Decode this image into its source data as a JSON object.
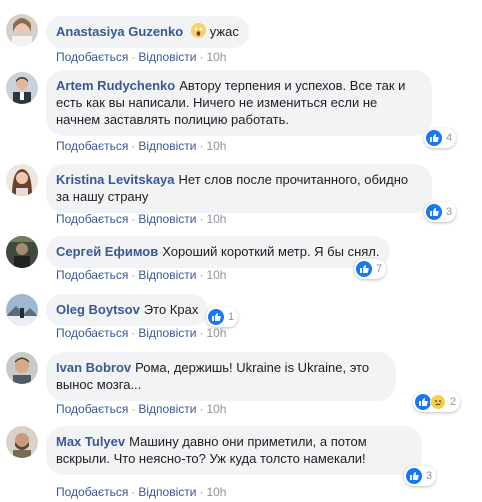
{
  "labels": {
    "like": "Подобається",
    "reply": "Відповісти",
    "sep": "·"
  },
  "comments": [
    {
      "author": "Anastasiya Guzenko",
      "text": "ужас",
      "time": "10h",
      "reactions": null
    },
    {
      "author": "Artem Rudychenko",
      "text": "Автору терпения и успехов. Все так и есть как вы написали. Ничего не измениться если не начнем заставлять полицию работать.",
      "time": "10h",
      "reactions": {
        "count": "4"
      }
    },
    {
      "author": "Kristina Levitskaya",
      "text": "Нет слов после прочитанного, обидно за нашу страну",
      "time": "10h",
      "reactions": {
        "count": "3"
      }
    },
    {
      "author": "Сергей Ефимов",
      "text": "Хороший короткий метр. Я бы снял.",
      "time": "10h",
      "reactions": {
        "count": "7"
      }
    },
    {
      "author": "Oleg Boytsov",
      "text": "Это Крах",
      "time": "10h",
      "reactions": {
        "count": "1"
      }
    },
    {
      "author": "Ivan Bobrov",
      "text": "Рома, держишь! Ukraine is Ukraine, это вынос мозга...",
      "time": "10h",
      "reactions": {
        "count": "2"
      }
    },
    {
      "author": "Max Tulyev",
      "text": "Машину давно они приметили, а потом вскрыли. Что неясно-то? Уж куда толсто намекали!",
      "time": "10h",
      "reactions": {
        "count": "3"
      }
    }
  ],
  "colors": {
    "link": "#385898",
    "bubble": "#f2f3f5",
    "like": "#1877f2"
  }
}
